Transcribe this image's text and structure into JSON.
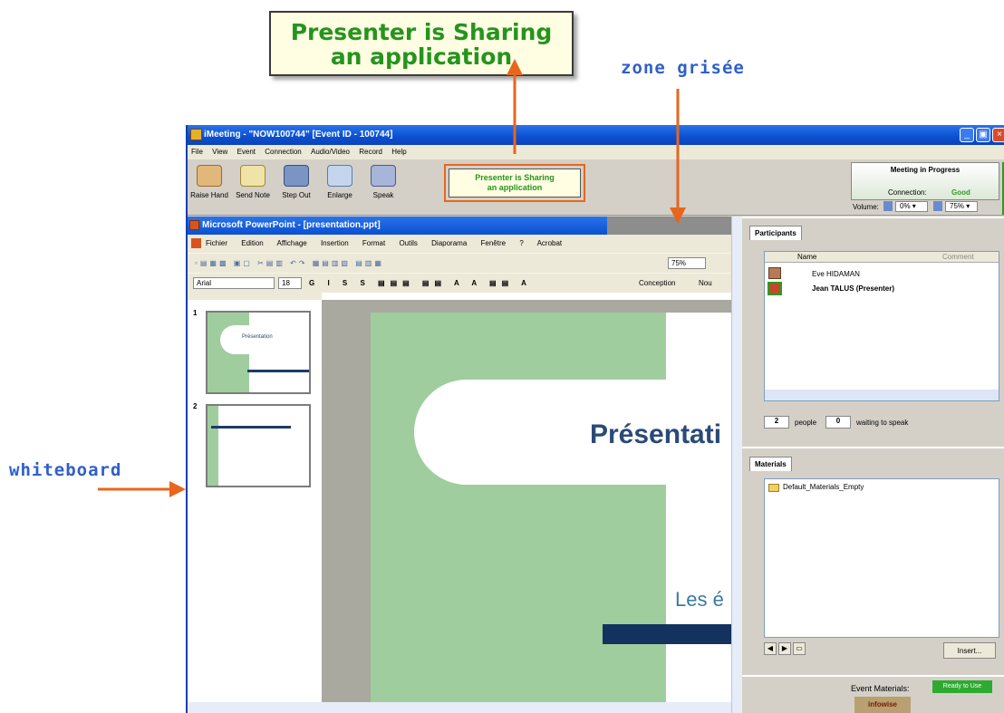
{
  "annotations": {
    "callout": [
      "Presenter is Sharing",
      "an application"
    ],
    "zone_grisee": "zone grisée",
    "whiteboard": "whiteboard"
  },
  "window": {
    "title": "iMeeting - \"NOW100744\" [Event ID - 100744]",
    "menu": [
      "File",
      "View",
      "Event",
      "Connection",
      "Audio/Video",
      "Record",
      "Help"
    ],
    "tools": [
      {
        "label": "Raise Hand",
        "icon": "raise-hand-icon"
      },
      {
        "label": "Send Note",
        "icon": "send-note-icon"
      },
      {
        "label": "Step Out",
        "icon": "step-out-icon"
      },
      {
        "label": "Enlarge",
        "icon": "enlarge-icon"
      },
      {
        "label": "Speak",
        "icon": "speak-icon"
      }
    ],
    "share_status": [
      "Presenter is Sharing",
      "an application"
    ],
    "status": {
      "heading": "Meeting in Progress",
      "connection_label": "Connection:",
      "connection_value": "Good",
      "volume_label": "Volume:",
      "vol_in": "0%",
      "vol_out": "75%"
    }
  },
  "powerpoint": {
    "title": "Microsoft PowerPoint - [presentation.ppt]",
    "menu": [
      "Fichier",
      "Edition",
      "Affichage",
      "Insertion",
      "Format",
      "Outils",
      "Diaporama",
      "Fenêtre",
      "?",
      "Acrobat"
    ],
    "zoom": "75%",
    "font": "Arial",
    "font_size": "18",
    "conception": "Conception",
    "nouvelle": "Nou",
    "slide_numbers": [
      "1",
      "2"
    ],
    "thumb1_title": "Présentation",
    "slide_title": "Présentati",
    "slide_subtitle": "Les é"
  },
  "participants": {
    "tab": "Participants",
    "col_name": "Name",
    "col_comment": "Comment",
    "rows": [
      {
        "name": "Eve HIDAMAN"
      },
      {
        "name": "Jean TALUS (Presenter)"
      }
    ],
    "people_count": "2",
    "people_label": "people",
    "waiting_count": "0",
    "waiting_label": "waiting to speak"
  },
  "materials": {
    "tab": "Materials",
    "items": [
      "Default_Materials_Empty"
    ],
    "insert": "Insert..."
  },
  "footer": {
    "event_materials": "Event Materials:",
    "ready": "Ready to Use",
    "brand": "infowise"
  }
}
